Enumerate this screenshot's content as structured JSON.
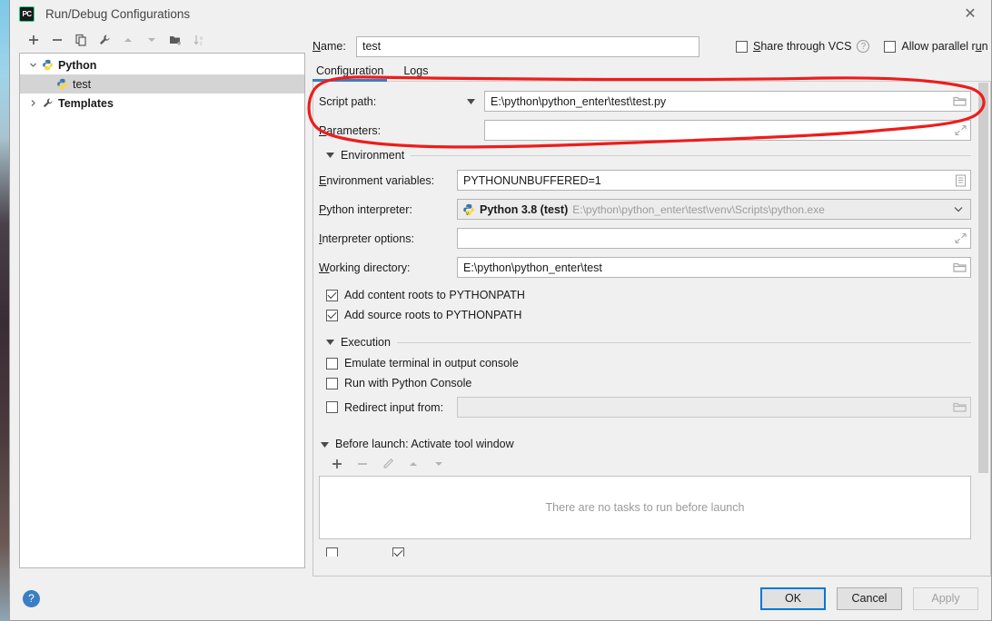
{
  "window": {
    "title": "Run/Debug Configurations",
    "app_icon": "pycharm-icon",
    "close_icon": "close-icon"
  },
  "tree_toolbar": {
    "buttons": [
      {
        "name": "add-button",
        "icon": "plus-icon",
        "enabled": true
      },
      {
        "name": "remove-button",
        "icon": "minus-icon",
        "enabled": true
      },
      {
        "name": "copy-button",
        "icon": "copy-icon",
        "enabled": true
      },
      {
        "name": "edit-templates-button",
        "icon": "wrench-icon",
        "enabled": true
      },
      {
        "name": "move-up-button",
        "icon": "arrow-up-icon",
        "enabled": false
      },
      {
        "name": "move-down-button",
        "icon": "arrow-down-icon",
        "enabled": false
      },
      {
        "name": "new-folder-button",
        "icon": "folder-add-icon",
        "enabled": true
      },
      {
        "name": "sort-button",
        "icon": "sort-az-icon",
        "enabled": false
      }
    ]
  },
  "tree": {
    "nodes": [
      {
        "label": "Python",
        "icon": "python-icon",
        "expanded": true,
        "arrow": "chevron-down-icon",
        "selected": false
      },
      {
        "label": "test",
        "icon": "python-icon",
        "child": true,
        "selected": true
      },
      {
        "label": "Templates",
        "icon": "wrench-icon",
        "expanded": false,
        "arrow": "chevron-right-icon",
        "selected": false
      }
    ]
  },
  "header": {
    "name_label": "Name:",
    "name_value": "test",
    "share_vcs_label": "Share through VCS",
    "share_vcs_checked": false,
    "help_icon": "question-icon",
    "allow_parallel_label": "Allow parallel run",
    "allow_parallel_checked": false
  },
  "tabs": [
    {
      "label": "Configuration",
      "active": true
    },
    {
      "label": "Logs",
      "active": false
    }
  ],
  "form": {
    "script_path_label": "Script path:",
    "script_path_value": "E:\\python\\python_enter\\test\\test.py",
    "script_path_browse_icon": "folder-icon",
    "script_path_combo_icon": "triangle-down-icon",
    "parameters_label": "Parameters:",
    "parameters_value": "",
    "parameters_expand_icon": "expand-icon",
    "environment_section": "Environment",
    "env_vars_label": "Environment variables:",
    "env_vars_value": "PYTHONUNBUFFERED=1",
    "env_vars_edit_icon": "list-icon",
    "interpreter_label": "Python interpreter:",
    "interpreter_name": "Python 3.8 (test)",
    "interpreter_path": "E:\\python\\python_enter\\test\\venv\\Scripts\\python.exe",
    "interpreter_icon": "python-venv-icon",
    "interpreter_chevron_icon": "chevron-down-icon",
    "interpreter_options_label": "Interpreter options:",
    "interpreter_options_value": "",
    "interpreter_options_expand_icon": "expand-icon",
    "working_dir_label": "Working directory:",
    "working_dir_value": "E:\\python\\python_enter\\test",
    "working_dir_browse_icon": "folder-icon",
    "add_content_roots_label": "Add content roots to PYTHONPATH",
    "add_content_roots_checked": true,
    "add_source_roots_label": "Add source roots to PYTHONPATH",
    "add_source_roots_checked": true,
    "execution_section": "Execution",
    "emulate_terminal_label": "Emulate terminal in output console",
    "emulate_terminal_checked": false,
    "run_python_console_label": "Run with Python Console",
    "run_python_console_checked": false,
    "redirect_input_label": "Redirect input from:",
    "redirect_input_checked": false,
    "redirect_input_value": "",
    "redirect_input_browse_icon": "folder-icon"
  },
  "before_launch": {
    "title": "Before launch: Activate tool window",
    "toolbar": [
      {
        "name": "add-task-button",
        "icon": "plus-icon",
        "enabled": true
      },
      {
        "name": "remove-task-button",
        "icon": "minus-icon",
        "enabled": false
      },
      {
        "name": "edit-task-button",
        "icon": "pencil-icon",
        "enabled": false
      },
      {
        "name": "task-up-button",
        "icon": "arrow-up-icon",
        "enabled": false
      },
      {
        "name": "task-down-button",
        "icon": "arrow-down-icon",
        "enabled": false
      }
    ],
    "empty_text": "There are no tasks to run before launch"
  },
  "footer": {
    "help_icon": "question-icon",
    "ok_label": "OK",
    "cancel_label": "Cancel",
    "apply_label": "Apply",
    "apply_enabled": false
  },
  "annotation": {
    "shape": "hand-drawn-ellipse",
    "color": "#ee1c1c",
    "encircles": "script-path-row"
  },
  "colors": {
    "accent_blue": "#3a7ec4",
    "focus_blue": "#0078d7",
    "annotation_red": "#ee1c1c",
    "dialog_bg": "#f0f0f0",
    "field_bg": "#ffffff",
    "selection_gray": "#d4d4d4"
  }
}
